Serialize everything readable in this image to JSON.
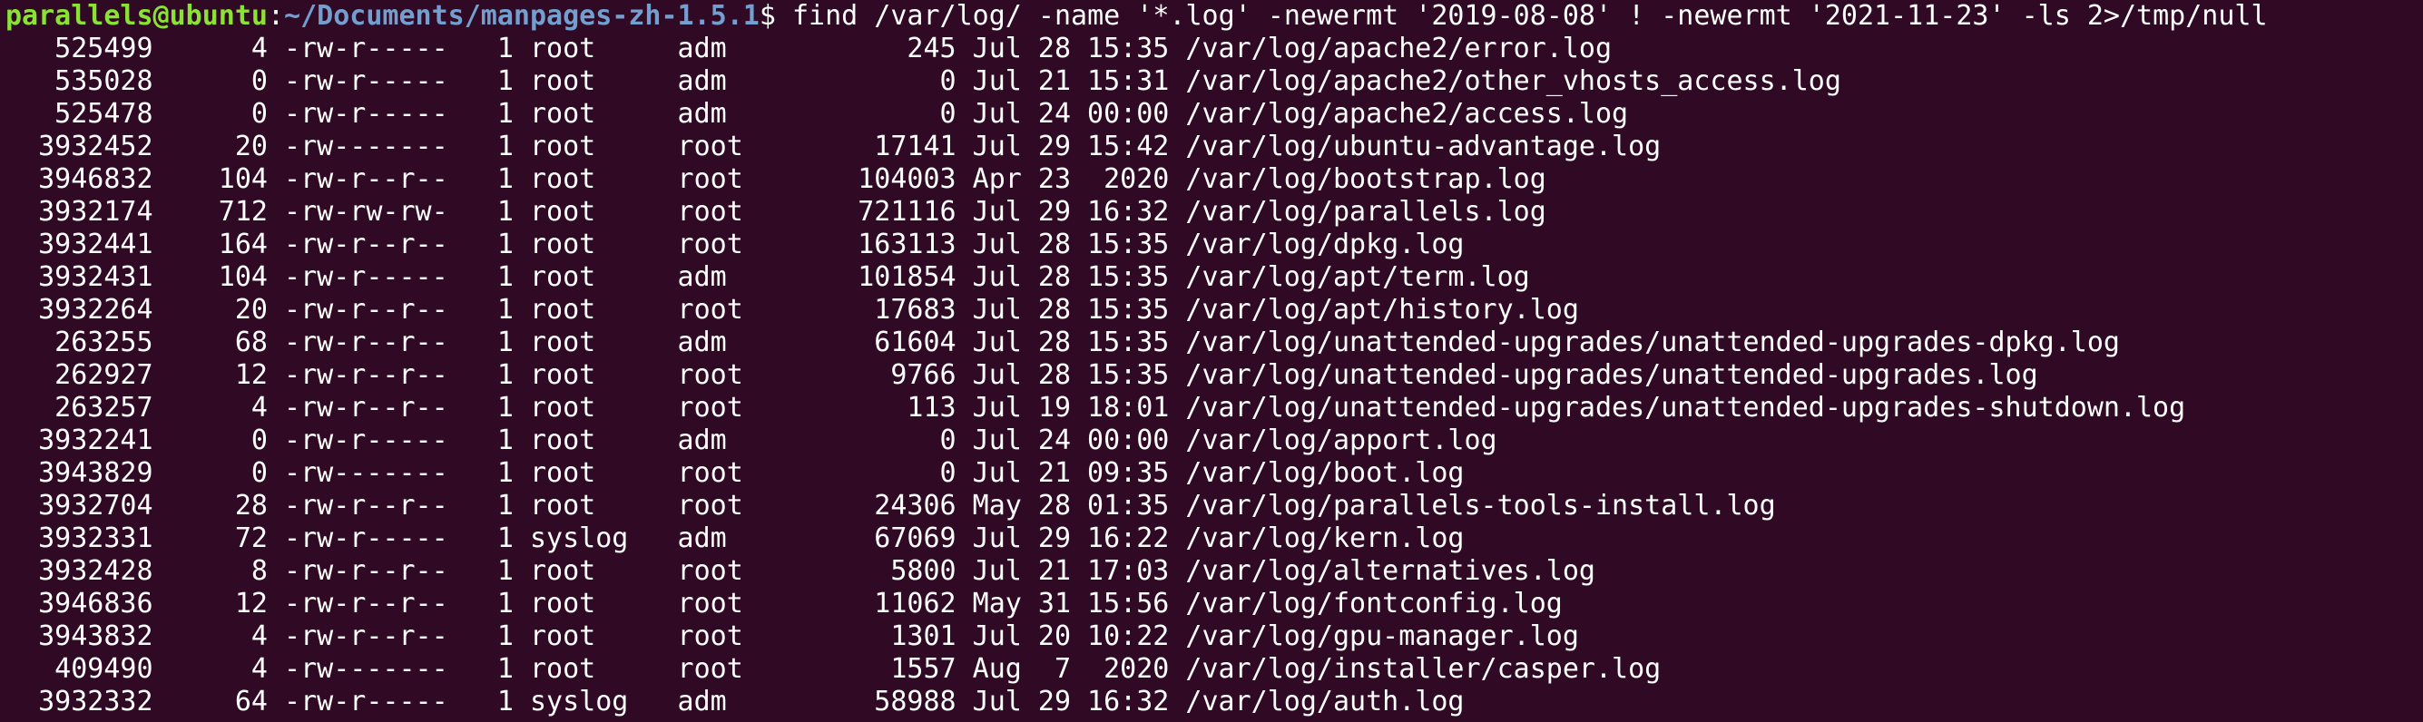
{
  "prompt": {
    "user_host": "parallels@ubuntu",
    "sep": ":",
    "path": "~/Documents/manpages-zh-1.5.1",
    "dollar": "$ ",
    "command": "find /var/log/ -name '*.log' -newermt '2019-08-08' ! -newermt '2021-11-23' -ls 2>/tmp/null"
  },
  "rows": [
    "   525499      4 -rw-r-----   1 root     adm           245 Jul 28 15:35 /var/log/apache2/error.log",
    "   535028      0 -rw-r-----   1 root     adm             0 Jul 21 15:31 /var/log/apache2/other_vhosts_access.log",
    "   525478      0 -rw-r-----   1 root     adm             0 Jul 24 00:00 /var/log/apache2/access.log",
    "  3932452     20 -rw-------   1 root     root        17141 Jul 29 15:42 /var/log/ubuntu-advantage.log",
    "  3946832    104 -rw-r--r--   1 root     root       104003 Apr 23  2020 /var/log/bootstrap.log",
    "  3932174    712 -rw-rw-rw-   1 root     root       721116 Jul 29 16:32 /var/log/parallels.log",
    "  3932441    164 -rw-r--r--   1 root     root       163113 Jul 28 15:35 /var/log/dpkg.log",
    "  3932431    104 -rw-r-----   1 root     adm        101854 Jul 28 15:35 /var/log/apt/term.log",
    "  3932264     20 -rw-r--r--   1 root     root        17683 Jul 28 15:35 /var/log/apt/history.log",
    "   263255     68 -rw-r--r--   1 root     adm         61604 Jul 28 15:35 /var/log/unattended-upgrades/unattended-upgrades-dpkg.log",
    "   262927     12 -rw-r--r--   1 root     root         9766 Jul 28 15:35 /var/log/unattended-upgrades/unattended-upgrades.log",
    "   263257      4 -rw-r--r--   1 root     root          113 Jul 19 18:01 /var/log/unattended-upgrades/unattended-upgrades-shutdown.log",
    "  3932241      0 -rw-r-----   1 root     adm             0 Jul 24 00:00 /var/log/apport.log",
    "  3943829      0 -rw-------   1 root     root            0 Jul 21 09:35 /var/log/boot.log",
    "  3932704     28 -rw-r--r--   1 root     root        24306 May 28 01:35 /var/log/parallels-tools-install.log",
    "  3932331     72 -rw-r-----   1 syslog   adm         67069 Jul 29 16:22 /var/log/kern.log",
    "  3932428      8 -rw-r--r--   1 root     root         5800 Jul 21 17:03 /var/log/alternatives.log",
    "  3946836     12 -rw-r--r--   1 root     root        11062 May 31 15:56 /var/log/fontconfig.log",
    "  3943832      4 -rw-r--r--   1 root     root         1301 Jul 20 10:22 /var/log/gpu-manager.log",
    "   409490      4 -rw-------   1 root     root         1557 Aug  7  2020 /var/log/installer/casper.log",
    "  3932332     64 -rw-r-----   1 syslog   adm         58988 Jul 29 16:32 /var/log/auth.log"
  ]
}
